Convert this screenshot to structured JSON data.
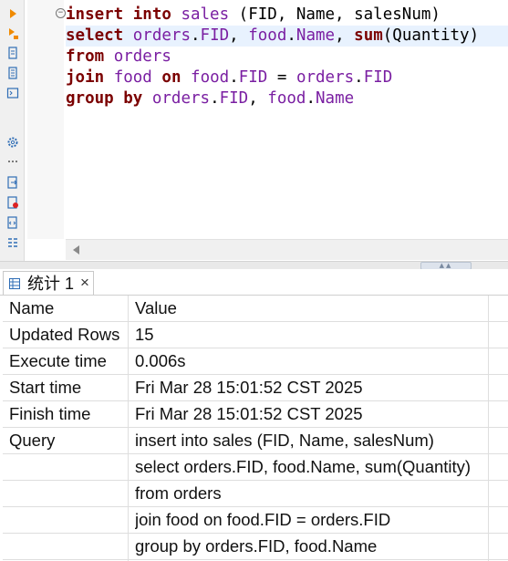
{
  "editor": {
    "gutter_icons": [
      "run-icon",
      "run-explain-icon",
      "script-icon",
      "script-list-icon",
      "terminal-icon",
      "settings-icon",
      "more-dots-icon",
      "export-icon",
      "error-file-icon",
      "file-code-icon",
      "format-icon"
    ],
    "lines": [
      [
        {
          "t": "insert into",
          "c": "kw"
        },
        {
          "t": " ",
          "c": "pl"
        },
        {
          "t": "sales",
          "c": "id"
        },
        {
          "t": " (FID, Name, salesNum)",
          "c": "pl"
        }
      ],
      [
        {
          "t": "select",
          "c": "kw"
        },
        {
          "t": " ",
          "c": "pl"
        },
        {
          "t": "orders",
          "c": "id"
        },
        {
          "t": ".",
          "c": "pl"
        },
        {
          "t": "FID",
          "c": "id"
        },
        {
          "t": ", ",
          "c": "pl"
        },
        {
          "t": "food",
          "c": "id"
        },
        {
          "t": ".",
          "c": "pl"
        },
        {
          "t": "Name",
          "c": "id"
        },
        {
          "t": ", ",
          "c": "pl"
        },
        {
          "t": "sum",
          "c": "kw"
        },
        {
          "t": "(Quantity)",
          "c": "pl"
        }
      ],
      [
        {
          "t": "from",
          "c": "kw"
        },
        {
          "t": " ",
          "c": "pl"
        },
        {
          "t": "orders",
          "c": "id"
        }
      ],
      [
        {
          "t": "join",
          "c": "kw"
        },
        {
          "t": " ",
          "c": "pl"
        },
        {
          "t": "food",
          "c": "id"
        },
        {
          "t": " ",
          "c": "pl"
        },
        {
          "t": "on",
          "c": "kw"
        },
        {
          "t": " ",
          "c": "pl"
        },
        {
          "t": "food",
          "c": "id"
        },
        {
          "t": ".",
          "c": "pl"
        },
        {
          "t": "FID",
          "c": "id"
        },
        {
          "t": " = ",
          "c": "pl"
        },
        {
          "t": "orders",
          "c": "id"
        },
        {
          "t": ".",
          "c": "pl"
        },
        {
          "t": "FID",
          "c": "id"
        }
      ],
      [
        {
          "t": "group by",
          "c": "kw"
        },
        {
          "t": " ",
          "c": "pl"
        },
        {
          "t": "orders",
          "c": "id"
        },
        {
          "t": ".",
          "c": "pl"
        },
        {
          "t": "FID",
          "c": "id"
        },
        {
          "t": ", ",
          "c": "pl"
        },
        {
          "t": "food",
          "c": "id"
        },
        {
          "t": ".",
          "c": "pl"
        },
        {
          "t": "Name",
          "c": "id"
        }
      ]
    ],
    "highlighted_line": 1
  },
  "results": {
    "tab_label": "统计 1",
    "close_glyph": "×",
    "header": {
      "name": "Name",
      "value": "Value"
    },
    "rows": [
      {
        "name": "Updated Rows",
        "value": "15"
      },
      {
        "name": "Execute time",
        "value": "0.006s"
      },
      {
        "name": "Start time",
        "value": "Fri Mar 28 15:01:52 CST 2025"
      },
      {
        "name": "Finish time",
        "value": "Fri Mar 28 15:01:52 CST 2025"
      },
      {
        "name": "Query",
        "value": "insert into sales (FID, Name, salesNum)"
      },
      {
        "name": "",
        "value": "select orders.FID, food.Name, sum(Quantity)"
      },
      {
        "name": "",
        "value": "from orders"
      },
      {
        "name": "",
        "value": "join food on food.FID = orders.FID"
      },
      {
        "name": "",
        "value": "group by orders.FID, food.Name"
      }
    ]
  },
  "colors": {
    "keyword": "#7b0000",
    "identifier": "#7a1fa2",
    "line_highlight": "#e8f2fe"
  }
}
